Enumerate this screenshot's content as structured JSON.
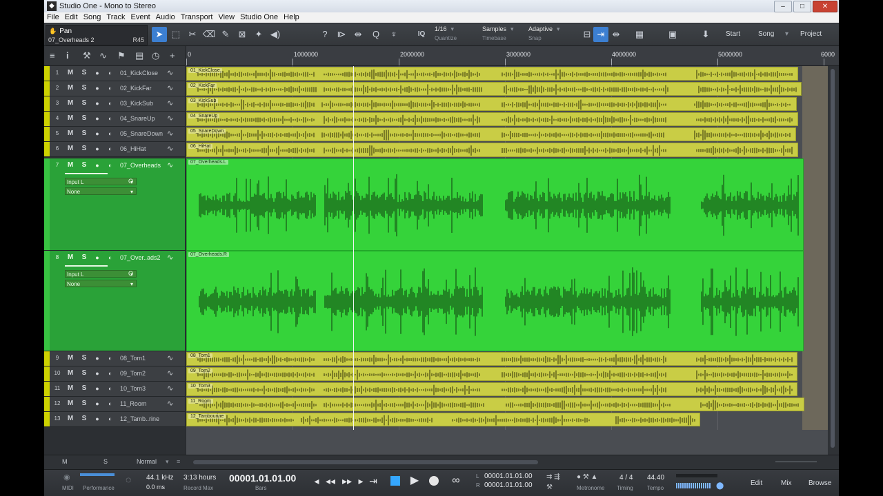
{
  "window": {
    "title": "Studio One - Mono to Stereo",
    "controls": [
      "–",
      "□",
      "✕"
    ]
  },
  "menu": [
    "File",
    "Edit",
    "Song",
    "Track",
    "Event",
    "Audio",
    "Transport",
    "View",
    "Studio One",
    "Help"
  ],
  "toolbar": {
    "info_param": "Pan",
    "info_track": "07_Overheads 2",
    "info_value": "R45",
    "quantize_value": "1/16",
    "quantize_label": "Quantize",
    "timebase_value": "Samples",
    "timebase_label": "Timebase",
    "snap_value": "Adaptive",
    "snap_label": "Snap",
    "iq_label": "IQ",
    "start_label": "Start",
    "song_label": "Song",
    "project_label": "Project"
  },
  "ruler": {
    "ticks": [
      "0",
      "1000000",
      "2000000",
      "3000000",
      "4000000",
      "5000000",
      "6000"
    ]
  },
  "tracks": [
    {
      "num": "1",
      "name": "01_KickClose",
      "event": "01_KickClose"
    },
    {
      "num": "2",
      "name": "02_KickFar",
      "event": "02_KickFar"
    },
    {
      "num": "3",
      "name": "03_KickSub",
      "event": "03_KickSub"
    },
    {
      "num": "4",
      "name": "04_SnareUp",
      "event": "04_SnareUp"
    },
    {
      "num": "5",
      "name": "05_SnareDown",
      "event": "05_SnareDown"
    },
    {
      "num": "6",
      "name": "06_HiHat",
      "event": "06_HiHat"
    },
    {
      "num": "7",
      "name": "07_Overheads",
      "event": "07_Overheads.L",
      "input": "Input L",
      "output": "None"
    },
    {
      "num": "8",
      "name": "07_Over..ads2",
      "event": "07_Overheads.R",
      "input": "Input L",
      "output": "None"
    },
    {
      "num": "9",
      "name": "08_Tom1",
      "event": "08_Tom1"
    },
    {
      "num": "10",
      "name": "09_Tom2",
      "event": "09_Tom2"
    },
    {
      "num": "11",
      "name": "10_Tom3",
      "event": "10_Tom3"
    },
    {
      "num": "12",
      "name": "11_Room",
      "event": "11_Room"
    },
    {
      "num": "13",
      "name": "12_Tamb..rine",
      "event": "12_Tambourine"
    }
  ],
  "track_buttons": {
    "mute": "M",
    "solo": "S"
  },
  "arrange_bottom": {
    "m": "M",
    "s": "S",
    "mode": "Normal"
  },
  "transport": {
    "midi_label": "MIDI",
    "performance_label": "Performance",
    "sample_rate": "44.1 kHz",
    "latency": "0.0 ms",
    "record_max_value": "3:13 hours",
    "record_max_label": "Record Max",
    "position": "00001.01.01.00",
    "position_label": "Bars",
    "loop_left_label": "L",
    "loop_left": "00001.01.01.00",
    "loop_right_label": "R",
    "loop_right": "00001.01.01.00",
    "metronome_label": "Metronome",
    "timing_value": "4 / 4",
    "timing_label": "Timing",
    "tempo_value": "44.40",
    "tempo_label": "Tempo",
    "edit_label": "Edit",
    "mix_label": "Mix",
    "browse_label": "Browse"
  },
  "colors": {
    "track_yellow": "#c9cd45",
    "track_green": "#35d33a",
    "accent_blue": "#3c7fd1"
  }
}
